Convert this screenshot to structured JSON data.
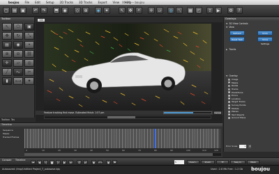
{
  "menubar": {
    "app": "boujou",
    "items": [
      "File",
      "Edit",
      "Setup",
      "2D Tracks",
      "3D Tracks",
      "Export",
      "View",
      "Help"
    ],
    "window_title": "XX-29 — boujou"
  },
  "toolbox": {
    "title": "Toolbox",
    "tabs": [
      "Toolbox",
      "Tas"
    ]
  },
  "viewer": {
    "zoom": "100",
    "status_text": "Feature tracking first move. Estimated finish: 1:57 pm",
    "progress_fraction": 0.62,
    "cancel_label": "Cancel"
  },
  "overlays_panel": {
    "title": "Overlays",
    "section_3d": "3D View Controls",
    "view_label": "View",
    "buttons": [
      "Refresh Tasks",
      "Undo Selection",
      "Reset Task",
      "Show Settings"
    ],
    "tracks_label": "Tracks",
    "overlay_label": "Overlay",
    "items": [
      {
        "label": "Image",
        "checked": true
      },
      {
        "label": "Masks",
        "checked": true
      },
      {
        "label": "Radial",
        "checked": true
      },
      {
        "label": "Tracks",
        "checked": true
      },
      {
        "label": "Predictions",
        "checked": false
      },
      {
        "label": "Errors",
        "checked": false
      },
      {
        "label": "Locators",
        "checked": false
      },
      {
        "label": "Target Tracks",
        "checked": false
      },
      {
        "label": "Survey Points",
        "checked": false
      },
      {
        "label": "Models",
        "checked": false
      },
      {
        "label": "Planes",
        "checked": false
      },
      {
        "label": "Test Objects",
        "checked": false
      },
      {
        "label": "Ground Plane",
        "checked": false
      }
    ],
    "error_scale_label": "Error Scale",
    "error_scale_value": "1"
  },
  "timeline": {
    "title": "Timeline",
    "rows": [
      "Sequence",
      "Masks",
      "Tracked Frames"
    ],
    "ruler": [
      "0",
      "10",
      "20",
      "30",
      "40",
      "50",
      "60",
      "70",
      "80",
      "90",
      "100",
      "110",
      "120"
    ]
  },
  "transport": {
    "tabs": [
      "Console",
      "Timeline"
    ],
    "frame": "5",
    "segments": [
      "Overl...",
      "Zoom",
      "TT",
      "Seq. In",
      "Mark"
    ]
  },
  "statusbar": {
    "message": "Autosaved: /tmp/Untitled Project_T_autosave.bjq",
    "used": "Used : 2.8 Mb",
    "free": "Free : 1.2 Gb",
    "logo": "boujou"
  },
  "colors": {
    "accent": "#2d6fb3",
    "panel_bg": "#3c3c3c",
    "app_bg": "#2b2b2b"
  }
}
